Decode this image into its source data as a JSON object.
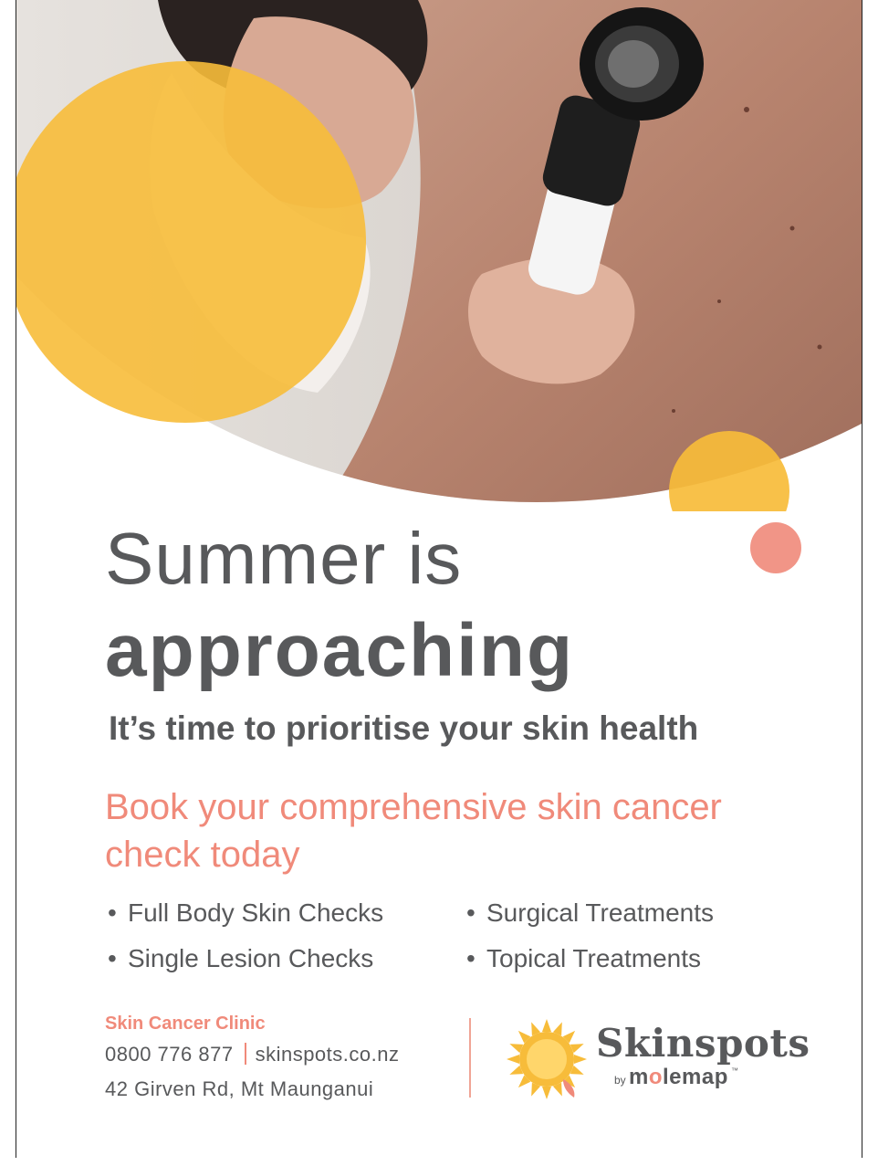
{
  "headline": {
    "line1": "Summer is",
    "line2": "approaching"
  },
  "subheadline": "It’s time to prioritise your skin health",
  "cta": "Book your comprehensive skin cancer check today",
  "services": [
    "Full Body Skin Checks",
    "Single Lesion Checks",
    "Surgical Treatments",
    "Topical Treatments"
  ],
  "clinic": {
    "name": "Skin Cancer Clinic",
    "phone": "0800 776 877",
    "website": "skinspots.co.nz",
    "address": "42 Girven Rd, Mt Maunganui"
  },
  "logo": {
    "wordmark": "Skinspots",
    "by": "by",
    "brand_prefix": "m",
    "brand_o": "o",
    "brand_suffix": "lemap",
    "tm": "™",
    "icon": "sun-icon"
  },
  "colors": {
    "yellow": "#F7BC3A",
    "coral": "#F08A7A",
    "text": "#58595B"
  }
}
